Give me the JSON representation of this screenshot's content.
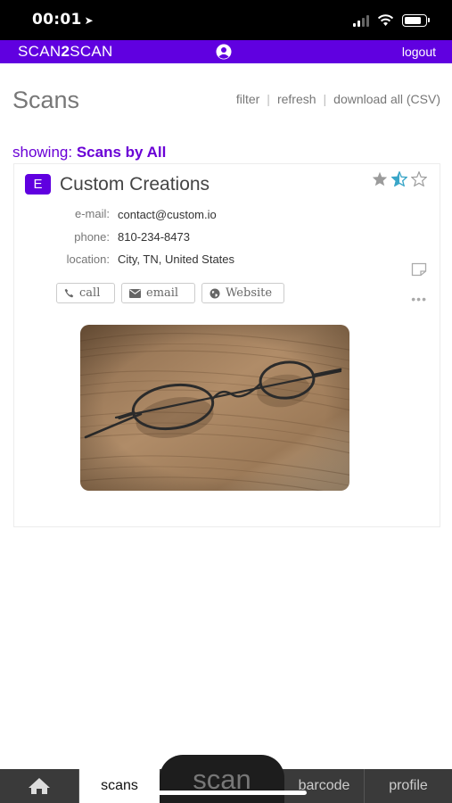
{
  "status_bar": {
    "time": "00:01",
    "location_glyph": "➤"
  },
  "app_bar": {
    "brand_part1": "SCAN",
    "brand_part2": "2",
    "brand_part3": "SCAN",
    "logout_label": "logout"
  },
  "page": {
    "title": "Scans",
    "links": {
      "filter": "filter",
      "refresh": "refresh",
      "download": "download all (CSV)",
      "separator": "|"
    },
    "showing_label": "showing:",
    "showing_value": "Scans by All"
  },
  "card": {
    "badge_letter": "E",
    "title": "Custom Creations",
    "rating": 1.5,
    "rating_max": 3,
    "fields": {
      "email_label": "e-mail:",
      "email_value": "contact@custom.io",
      "phone_label": "phone:",
      "phone_value": "810-234-8473",
      "location_label": "location:",
      "location_value": "City, TN, United States"
    },
    "buttons": {
      "call": "call",
      "email": "email",
      "website": "Website"
    },
    "more": "•••"
  },
  "tabs": {
    "home_icon": "home-icon",
    "scans": "scans",
    "scan": "scan",
    "barcode": "barcode",
    "profile": "profile"
  },
  "colors": {
    "brand": "#6000e0",
    "star_half": "#3aa6c8",
    "star_full": "#9b9b9b"
  }
}
